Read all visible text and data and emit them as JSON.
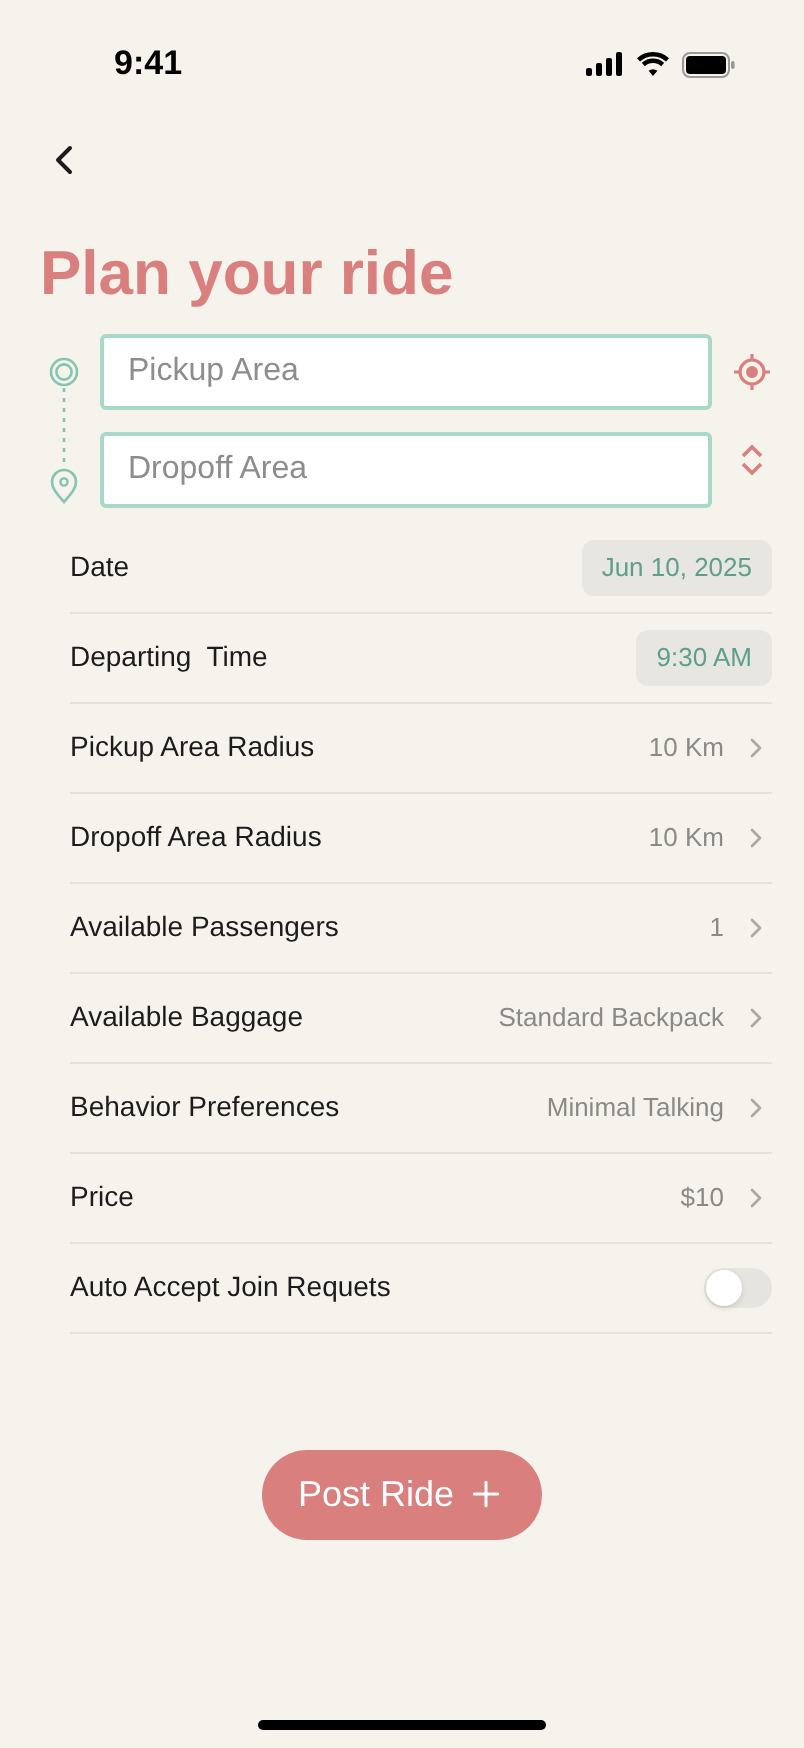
{
  "status_bar": {
    "time": "9:41"
  },
  "title": "Plan your ride",
  "route": {
    "pickup": {
      "placeholder": "Pickup Area"
    },
    "dropoff": {
      "placeholder": "Dropoff Area"
    }
  },
  "settings": [
    {
      "kind": "pill",
      "label": "Date",
      "value": "Jun 10, 2025"
    },
    {
      "kind": "pill",
      "label": "Departing  Time",
      "value": "9:30 AM"
    },
    {
      "kind": "link",
      "label": "Pickup Area Radius",
      "value": "10 Km"
    },
    {
      "kind": "link",
      "label": "Dropoff Area Radius",
      "value": "10 Km"
    },
    {
      "kind": "link",
      "label": "Available Passengers",
      "value": "1"
    },
    {
      "kind": "link",
      "label": "Available Baggage",
      "value": "Standard Backpack"
    },
    {
      "kind": "link",
      "label": "Behavior Preferences",
      "value": "Minimal Talking"
    },
    {
      "kind": "link",
      "label": "Price",
      "value": "$10"
    },
    {
      "kind": "toggle",
      "label": "Auto Accept Join Requets",
      "on": false
    }
  ],
  "post_button": {
    "label": "Post Ride"
  }
}
